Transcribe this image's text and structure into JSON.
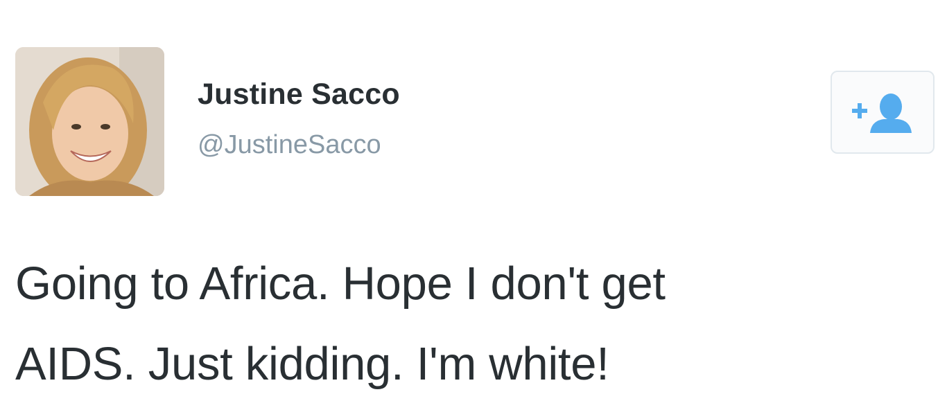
{
  "user": {
    "name": "Justine Sacco",
    "handle": "@JustineSacco",
    "avatar_icon": "profile-photo"
  },
  "follow_button": {
    "icon": "follow-user-icon",
    "color": "#55acee"
  },
  "tweet": {
    "line1": "Going to Africa. Hope I don't get",
    "line2": "AIDS. Just kidding. I'm white!"
  }
}
